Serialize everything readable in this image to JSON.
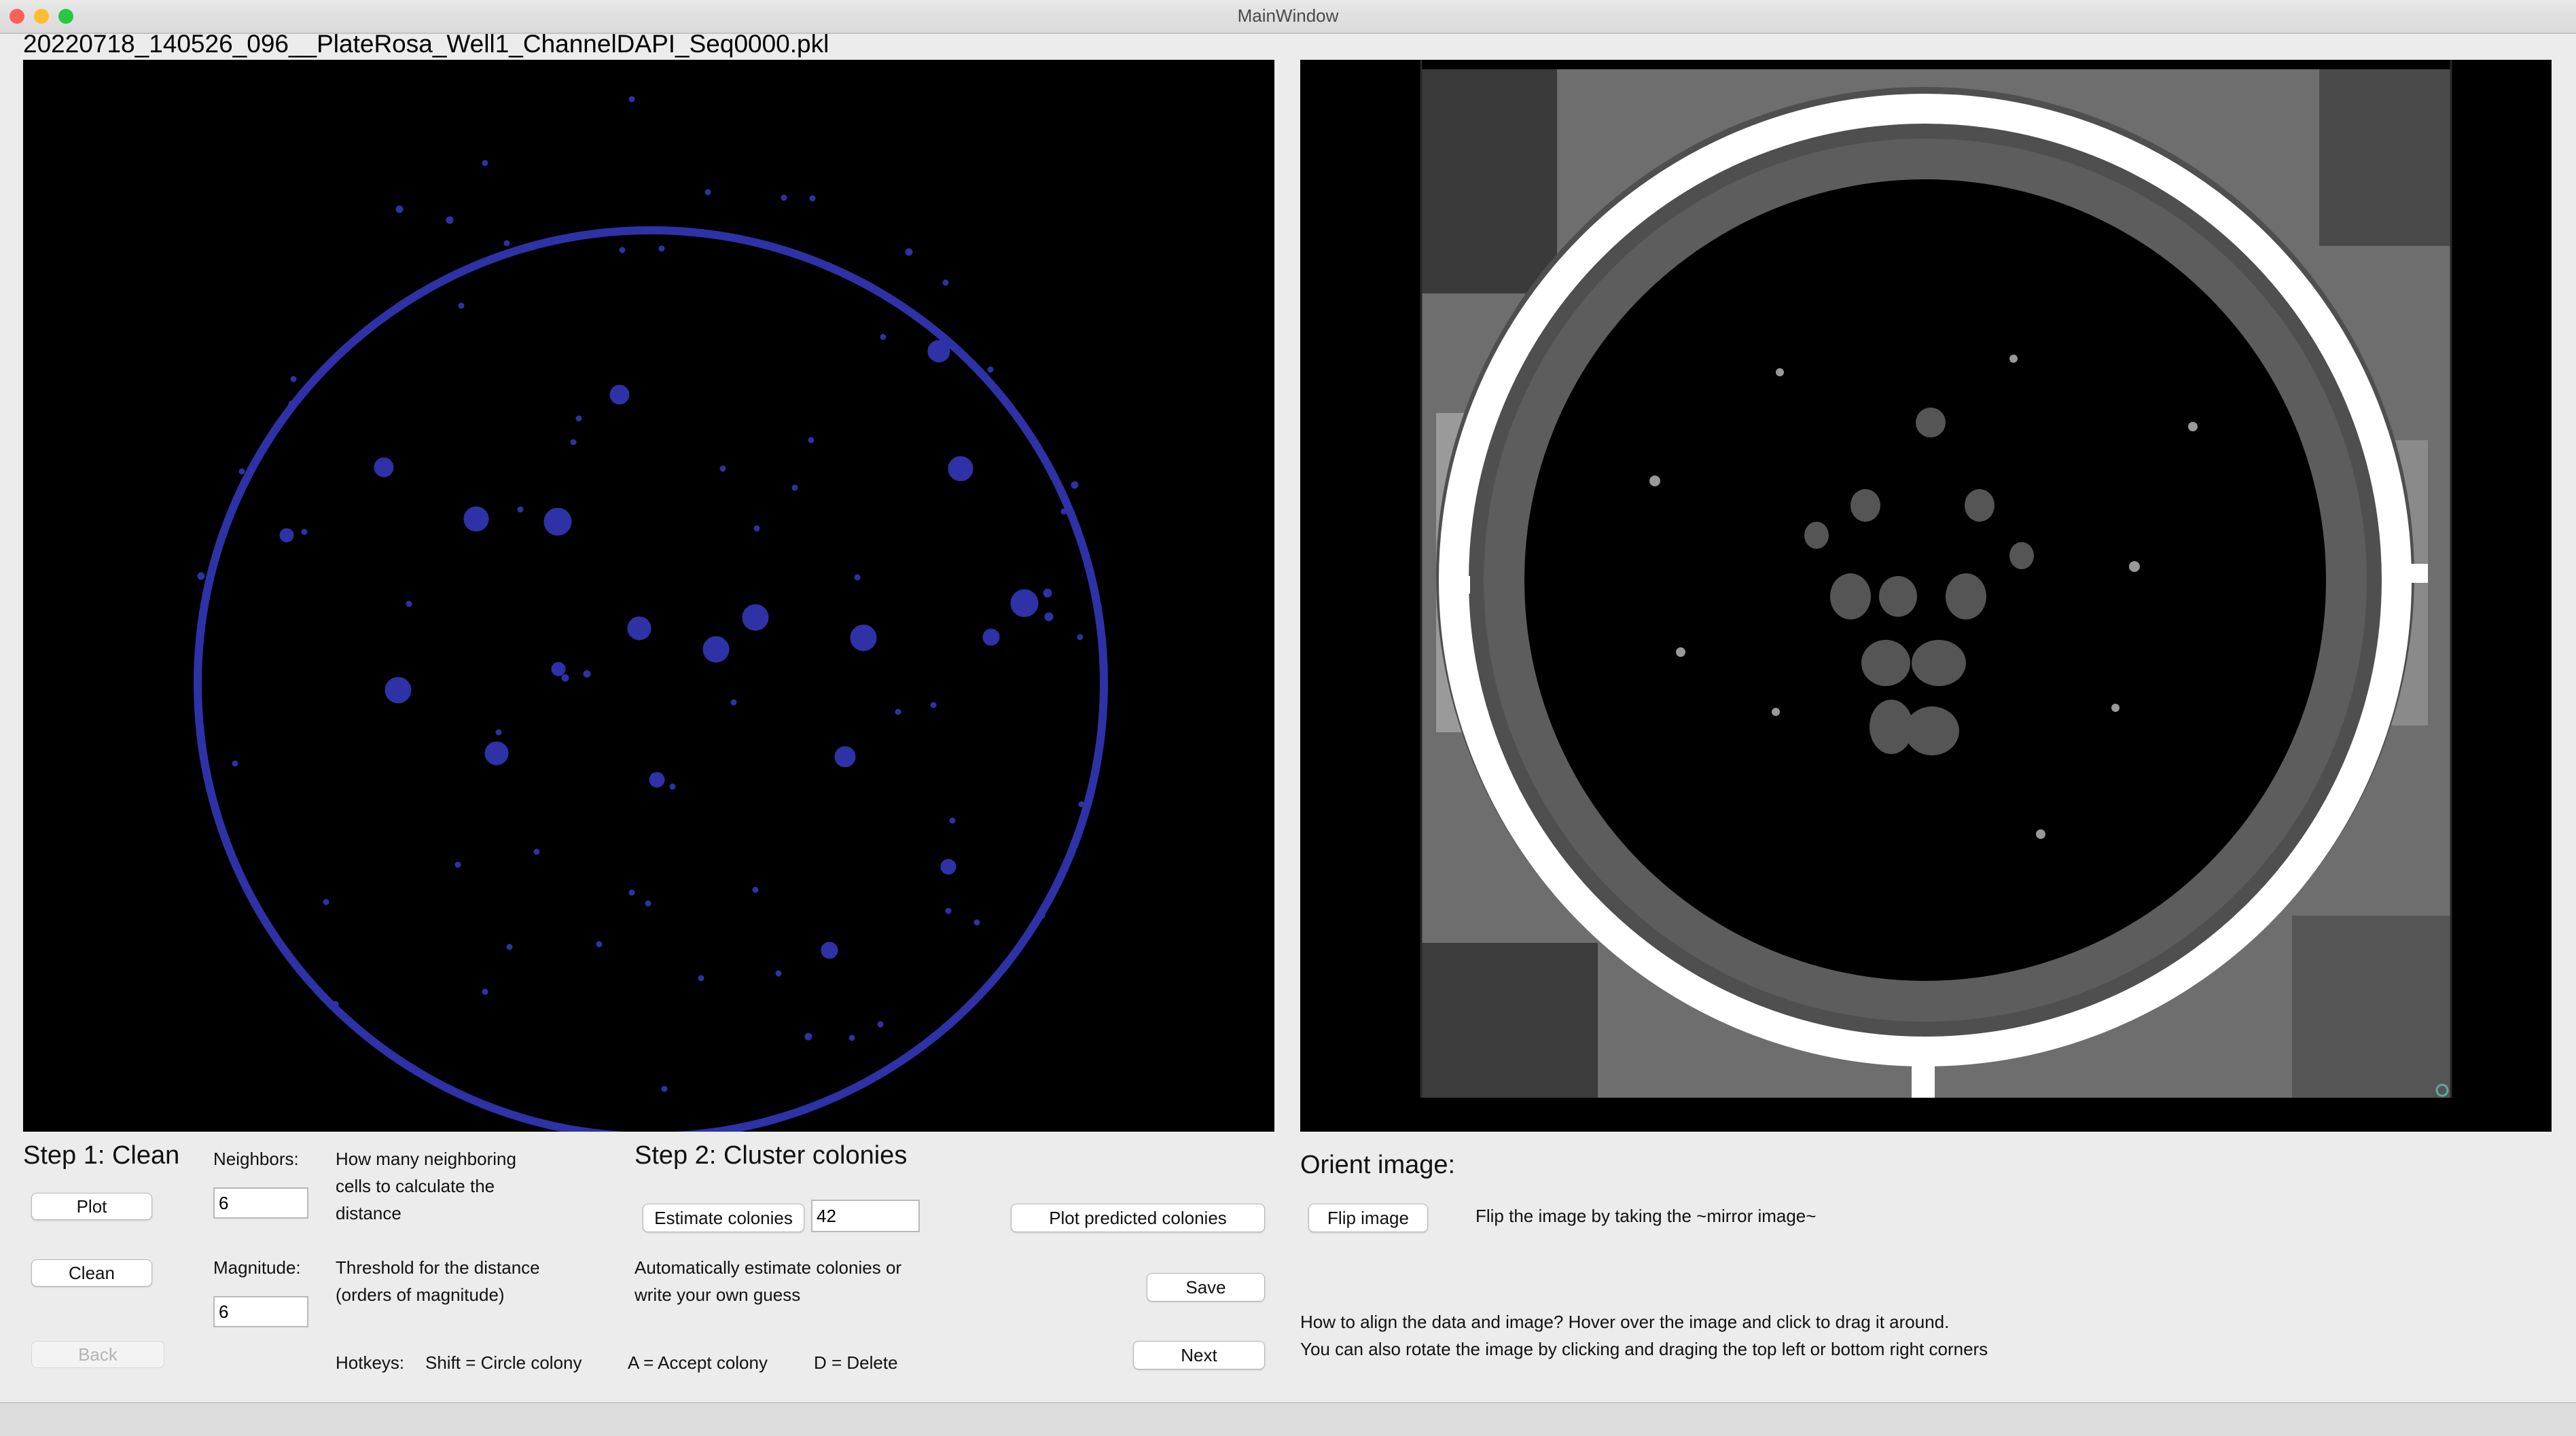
{
  "window": {
    "title": "MainWindow",
    "controls": {
      "close_color": "#fe5f57",
      "minimize_color": "#febc2e",
      "zoom_color": "#28c840"
    }
  },
  "file": {
    "name": "20220718_140526_096__PlateRosa_Well1_ChannelDAPI_Seq0000.pkl"
  },
  "colors": {
    "cell_points": "#2e32a6",
    "panel_bg": "#000000",
    "window_bg": "#ececec"
  },
  "step1": {
    "title": "Step 1: Clean",
    "plot_label": "Plot",
    "clean_label": "Clean",
    "back_label": "Back",
    "neighbors_label": "Neighbors:",
    "neighbors_value": "6",
    "neighbors_help": [
      "How many neighboring",
      "cells to calculate the",
      "distance"
    ],
    "magnitude_label": "Magnitude:",
    "magnitude_value": "6",
    "magnitude_help": [
      "Threshold for the distance",
      "(orders of magnitude)"
    ]
  },
  "hotkeys": {
    "label": "Hotkeys:",
    "shift": "Shift = Circle colony",
    "accept": "A = Accept colony",
    "delete": "D = Delete"
  },
  "step2": {
    "title": "Step 2: Cluster colonies",
    "estimate_label": "Estimate colonies",
    "estimate_value": "42",
    "help": [
      "Automatically estimate colonies or",
      "write your own guess"
    ],
    "plot_predicted_label": "Plot predicted colonies",
    "save_label": "Save",
    "next_label": "Next"
  },
  "orient": {
    "title": "Orient image:",
    "flip_label": "Flip image",
    "flip_help": "Flip the image by taking the ~mirror image~",
    "align_help": [
      "How to align the data and image? Hover over the image and click to drag it around.",
      "You can also rotate the image by clicking and draging the top left or bottom right corners"
    ]
  }
}
